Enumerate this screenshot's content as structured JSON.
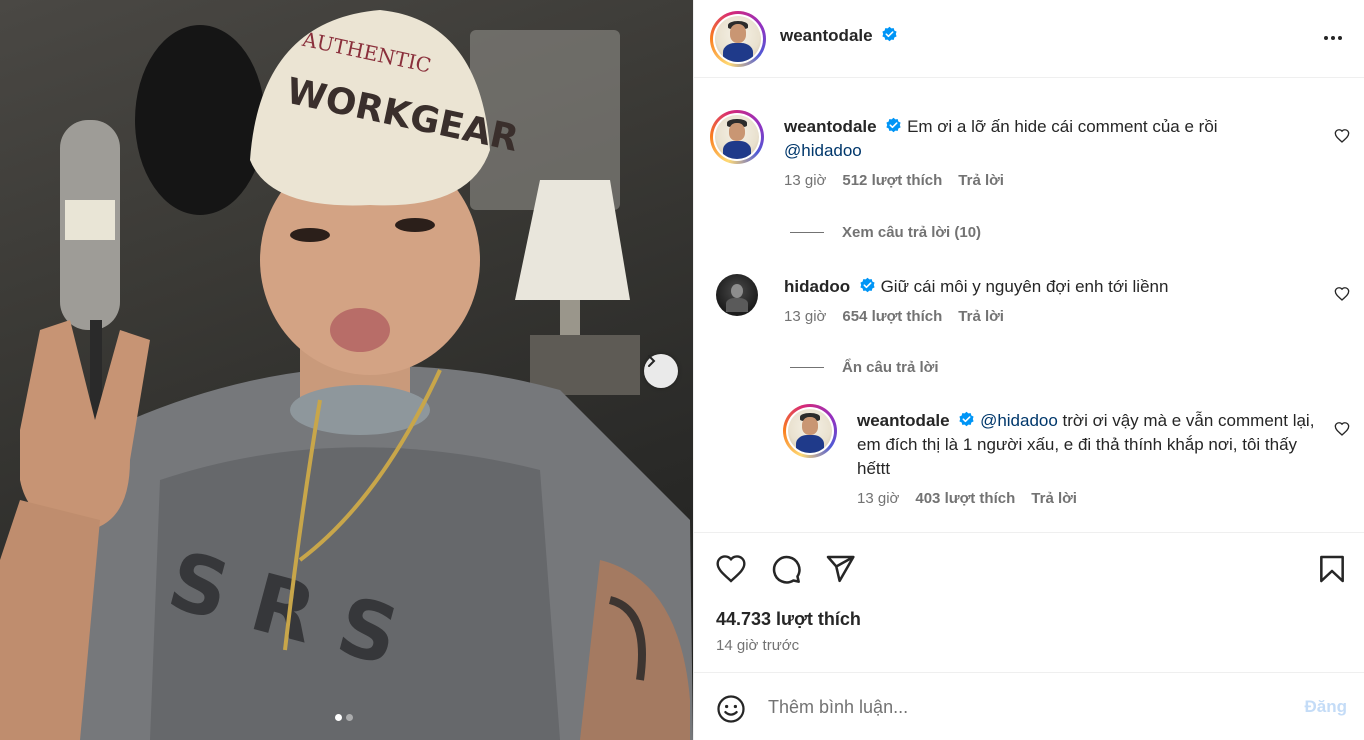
{
  "post": {
    "author": "weantodale",
    "more_icon": "more-horizontal-icon"
  },
  "photo": {
    "next_icon": "chevron-right-icon",
    "hat_text": "WORKGEAR",
    "slide_count": 2,
    "active_slide": 1
  },
  "comments": [
    {
      "user": "weantodale",
      "text": "Em ơi a lỡ ấn hide cái comment của e rồi",
      "mention": "@hidadoo",
      "time": "13 giờ",
      "likes": "512 lượt thích",
      "reply_label": "Trả lời",
      "replies_toggle": "Xem câu trả lời (10)"
    },
    {
      "user": "hidadoo",
      "text": "Giữ cái môi y nguyên đợi enh tới liềnn",
      "time": "13 giờ",
      "likes": "654 lượt thích",
      "reply_label": "Trả lời",
      "replies_toggle": "Ẩn câu trả lời",
      "reply": {
        "user": "weantodale",
        "mention": "@hidadoo",
        "text": " trời ơi vậy mà e vẫn comment lại, em đích thị là 1 người xấu, e đi thả thính khắp nơi, tôi thấy hếttt",
        "time": "13 giờ",
        "likes": "403 lượt thích",
        "reply_label": "Trả lời"
      }
    }
  ],
  "actions": {
    "like_icon": "heart-icon",
    "comment_icon": "comment-icon",
    "share_icon": "send-icon",
    "save_icon": "bookmark-icon",
    "likes": "44.733 lượt thích",
    "time_ago": "14 giờ trước"
  },
  "compose": {
    "emoji_icon": "smiley-icon",
    "placeholder": "Thêm bình luận...",
    "post_label": "Đăng"
  },
  "colors": {
    "link": "#00376b",
    "verified": "#0095f6",
    "muted": "#737373",
    "post_disabled": "#c4dcf7"
  }
}
